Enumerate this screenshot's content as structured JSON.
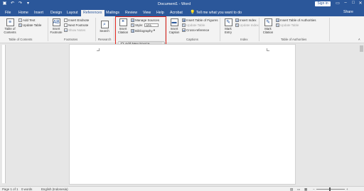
{
  "window": {
    "title": "Document1 - Word",
    "sign_in": "Sign in",
    "share": "Share"
  },
  "qat": [
    "save-icon",
    "undo-icon",
    "redo-icon",
    "customize-icon"
  ],
  "tabs": [
    {
      "label": "File"
    },
    {
      "label": "Home"
    },
    {
      "label": "Insert"
    },
    {
      "label": "Design"
    },
    {
      "label": "Layout"
    },
    {
      "label": "References",
      "active": true
    },
    {
      "label": "Mailings"
    },
    {
      "label": "Review"
    },
    {
      "label": "View"
    },
    {
      "label": "Help"
    },
    {
      "label": "Acrobat"
    }
  ],
  "tell_me": "Tell me what you want to do",
  "ribbon": {
    "toc": {
      "table_of_contents": "Table of Contents",
      "add_text": "Add Text",
      "update_table": "Update Table",
      "group": "Table of Contents"
    },
    "footnotes": {
      "insert_footnote": "Insert Footnote",
      "insert_endnote": "Insert Endnote",
      "next_footnote": "Next Footnote",
      "show_notes": "Show Notes",
      "group": "Footnotes"
    },
    "research": {
      "search": "Search",
      "group": "Research"
    },
    "citations": {
      "insert_citation": "Insert Citation",
      "manage_sources": "Manage Sources",
      "style_label": "Style:",
      "style_value": "APA",
      "bibliography": "Bibliography",
      "group": "Citations & Bibliography"
    },
    "captions": {
      "insert_caption": "Insert Caption",
      "insert_table_of_figures": "Insert Table of Figures",
      "update_table": "Update Table",
      "cross_reference": "Cross-reference",
      "group": "Captions"
    },
    "index": {
      "mark_entry": "Mark Entry",
      "insert_index": "Insert Index",
      "update_index": "Update Index",
      "group": "Index"
    },
    "toa": {
      "mark_citation": "Mark Citation",
      "insert_table_of_authorities": "Insert Table of Authorities",
      "update_table": "Update Table",
      "group": "Table of Authorities"
    }
  },
  "dropdown": {
    "add_new_source": "Add New Source...",
    "add_new_placeholder": "Add New Placeholder..."
  },
  "status": {
    "page": "Page 1 of 1",
    "words": "0 words",
    "language": "English (Indonesia)"
  },
  "colors": {
    "brand": "#2b579a",
    "highlight": "#e2231a"
  }
}
